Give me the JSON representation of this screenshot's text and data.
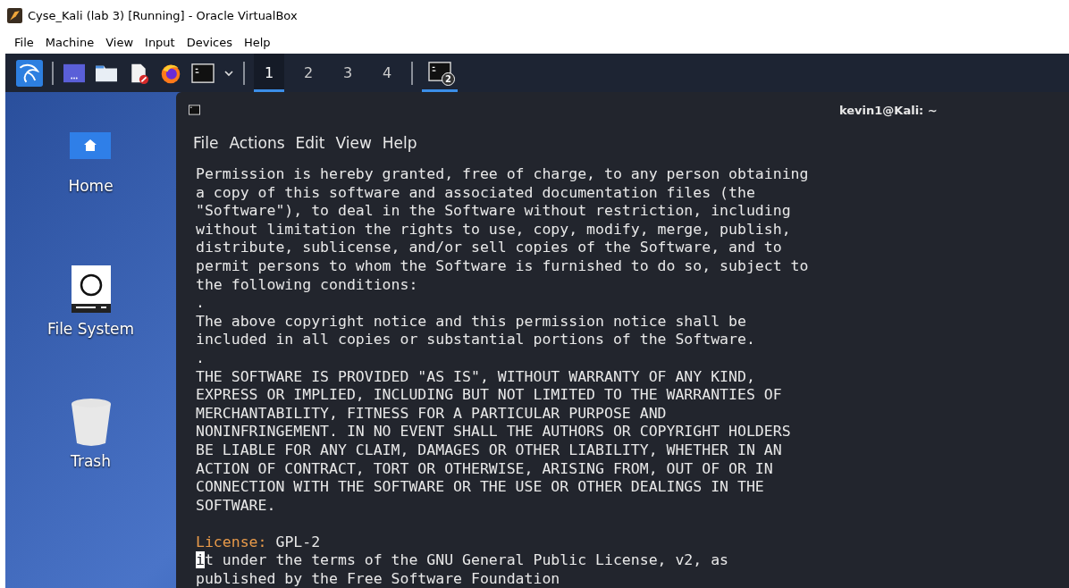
{
  "window": {
    "title": "Cyse_Kali (lab 3) [Running] - Oracle VirtualBox"
  },
  "menu": [
    "File",
    "Machine",
    "View",
    "Input",
    "Devices",
    "Help"
  ],
  "panel": {
    "workspaces": [
      {
        "label": "1",
        "selected": true
      },
      {
        "label": "2",
        "selected": false
      },
      {
        "label": "3",
        "selected": false
      },
      {
        "label": "4",
        "selected": false
      }
    ],
    "task": {
      "badge": "2",
      "selected": true
    }
  },
  "desktop_icons": [
    {
      "kind": "home",
      "label": "Home"
    },
    {
      "kind": "drive",
      "label": "File System"
    },
    {
      "kind": "trash",
      "label": "Trash"
    }
  ],
  "terminal": {
    "title": "kevin1@Kali: ~",
    "menu": [
      "File",
      "Actions",
      "Edit",
      "View",
      "Help"
    ],
    "lines": [
      {
        "kind": "text",
        "text": "Permission is hereby granted, free of charge, to any person obtaining"
      },
      {
        "kind": "text",
        "text": "a copy of this software and associated documentation files (the"
      },
      {
        "kind": "text",
        "text": "\"Software\"), to deal in the Software without restriction, including"
      },
      {
        "kind": "text",
        "text": "without limitation the rights to use, copy, modify, merge, publish,"
      },
      {
        "kind": "text",
        "text": "distribute, sublicense, and/or sell copies of the Software, and to"
      },
      {
        "kind": "text",
        "text": "permit persons to whom the Software is furnished to do so, subject to"
      },
      {
        "kind": "text",
        "text": "the following conditions:"
      },
      {
        "kind": "text",
        "text": "."
      },
      {
        "kind": "text",
        "text": "The above copyright notice and this permission notice shall be"
      },
      {
        "kind": "text",
        "text": "included in all copies or substantial portions of the Software."
      },
      {
        "kind": "text",
        "text": "."
      },
      {
        "kind": "text",
        "text": "THE SOFTWARE IS PROVIDED \"AS IS\", WITHOUT WARRANTY OF ANY KIND,"
      },
      {
        "kind": "text",
        "text": "EXPRESS OR IMPLIED, INCLUDING BUT NOT LIMITED TO THE WARRANTIES OF"
      },
      {
        "kind": "text",
        "text": "MERCHANTABILITY, FITNESS FOR A PARTICULAR PURPOSE AND"
      },
      {
        "kind": "text",
        "text": "NONINFRINGEMENT. IN NO EVENT SHALL THE AUTHORS OR COPYRIGHT HOLDERS"
      },
      {
        "kind": "text",
        "text": "BE LIABLE FOR ANY CLAIM, DAMAGES OR OTHER LIABILITY, WHETHER IN AN"
      },
      {
        "kind": "text",
        "text": "ACTION OF CONTRACT, TORT OR OTHERWISE, ARISING FROM, OUT OF OR IN"
      },
      {
        "kind": "text",
        "text": "CONNECTION WITH THE SOFTWARE OR THE USE OR OTHER DEALINGS IN THE"
      },
      {
        "kind": "text",
        "text": "SOFTWARE."
      },
      {
        "kind": "blank"
      },
      {
        "kind": "field",
        "label": "License:",
        "value": "GPL-2"
      },
      {
        "kind": "cursor",
        "text": "it under the terms of the GNU General Public License, v2, as"
      },
      {
        "kind": "text",
        "text": "published by the Free Software Foundation"
      }
    ]
  }
}
